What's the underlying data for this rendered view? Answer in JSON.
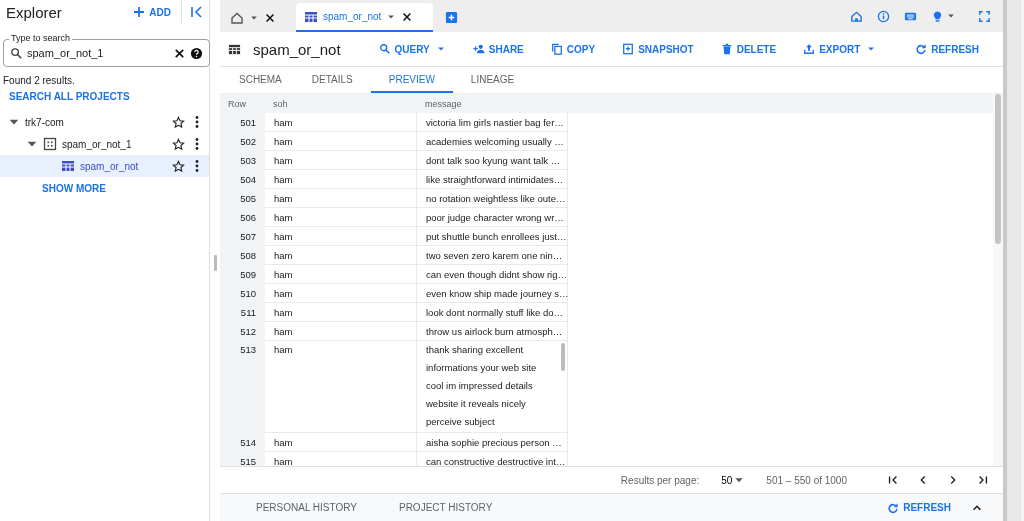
{
  "explorer": {
    "title": "Explorer",
    "add_label": "ADD",
    "search": {
      "label": "Type to search",
      "value": "spam_or_not_1"
    },
    "result_text": "Found 2 results.",
    "search_all": "SEARCH ALL PROJECTS",
    "tree": [
      {
        "label": "trk7-com",
        "kind": "project",
        "expanded": true,
        "selected": false,
        "children": [
          {
            "label": "spam_or_not_1",
            "kind": "dataset",
            "expanded": true,
            "selected": false,
            "children": [
              {
                "label": "spam_or_not",
                "kind": "table",
                "selected": true
              }
            ]
          }
        ]
      }
    ],
    "show_more": "SHOW MORE"
  },
  "tabs": [
    {
      "kind": "home",
      "selected": false
    },
    {
      "kind": "table",
      "label": "spam_or_not",
      "selected": true
    }
  ],
  "title": "spam_or_not",
  "actions": [
    {
      "kind": "query",
      "label": "QUERY",
      "menu": true
    },
    {
      "kind": "share",
      "label": "SHARE",
      "menu": false
    },
    {
      "kind": "copy",
      "label": "COPY",
      "menu": false
    },
    {
      "kind": "snapshot",
      "label": "SNAPSHOT",
      "menu": false
    },
    {
      "kind": "delete",
      "label": "DELETE",
      "menu": false
    },
    {
      "kind": "export",
      "label": "EXPORT",
      "menu": true
    }
  ],
  "refresh_label": "REFRESH",
  "subtabs": [
    {
      "label": "SCHEMA",
      "selected": false
    },
    {
      "label": "DETAILS",
      "selected": false
    },
    {
      "label": "PREVIEW",
      "selected": true
    },
    {
      "label": "LINEAGE",
      "selected": false
    }
  ],
  "table": {
    "columns": [
      "Row",
      "soh",
      "message"
    ],
    "rows": [
      {
        "row": "501",
        "soh": "ham",
        "message": "victoria lim girls nastier bag fer…",
        "expanded": false
      },
      {
        "row": "502",
        "soh": "ham",
        "message": "academies welcoming usually …",
        "expanded": false
      },
      {
        "row": "503",
        "soh": "ham",
        "message": "dont talk soo  kyung want talk …",
        "expanded": false
      },
      {
        "row": "504",
        "soh": "ham",
        "message": "like straightforward intimidates…",
        "expanded": false
      },
      {
        "row": "505",
        "soh": "ham",
        "message": "no rotation weightless like oute…",
        "expanded": false
      },
      {
        "row": "506",
        "soh": "ham",
        "message": "poor judge character wrong wr…",
        "expanded": false
      },
      {
        "row": "507",
        "soh": "ham",
        "message": "put shuttle bunch enrollees just…",
        "expanded": false
      },
      {
        "row": "508",
        "soh": "ham",
        "message": "two  seven  zero karem one  nin…",
        "expanded": false
      },
      {
        "row": "509",
        "soh": "ham",
        "message": "can even though didnt show rig…",
        "expanded": false
      },
      {
        "row": "510",
        "soh": "ham",
        "message": "even know ship made journey s…",
        "expanded": false
      },
      {
        "row": "511",
        "soh": "ham",
        "message": "look dont normally stuff like do…",
        "expanded": false
      },
      {
        "row": "512",
        "soh": "ham",
        "message": "throw us airlock burn atmosph…",
        "expanded": false
      },
      {
        "row": "513",
        "soh": "ham",
        "message": "thank sharing excellent informations  your web site cool  im impressed details website  it reveals nicely perceive subject",
        "expanded": true
      },
      {
        "row": "514",
        "soh": "ham",
        "message": "aisha sophie precious person …",
        "expanded": false
      },
      {
        "row": "515",
        "soh": "ham",
        "message": "can constructive destructive int…",
        "expanded": false
      }
    ]
  },
  "pagination": {
    "label": "Results per page:",
    "per_page": "50",
    "range": "501 – 550 of 1000"
  },
  "bottom": {
    "tabs": [
      "PERSONAL HISTORY",
      "PROJECT HISTORY"
    ],
    "refresh": "REFRESH"
  }
}
